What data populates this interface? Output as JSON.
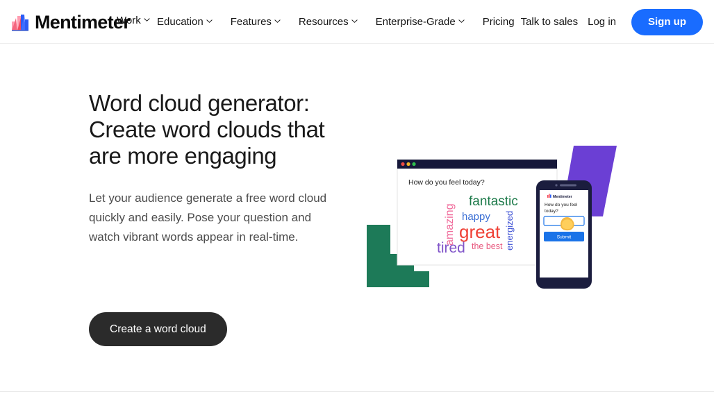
{
  "brand": {
    "name": "Mentimeter",
    "logo_icon": "mentimeter-bars-logo-icon",
    "colors": {
      "pink": "#ff9cb0",
      "red": "#f24b5e",
      "blue": "#2b5cf5",
      "light_blue": "#5b8cff"
    }
  },
  "nav": {
    "items": [
      {
        "label": "Work",
        "has_chevron": true,
        "icon": "chevron-down-icon"
      },
      {
        "label": "Education",
        "has_chevron": true,
        "icon": "chevron-down-icon"
      },
      {
        "label": "Features",
        "has_chevron": true,
        "icon": "chevron-down-icon"
      },
      {
        "label": "Resources",
        "has_chevron": true,
        "icon": "chevron-down-icon"
      },
      {
        "label": "Enterprise-Grade",
        "has_chevron": true,
        "icon": "chevron-down-icon"
      },
      {
        "label": "Pricing",
        "has_chevron": false,
        "icon": ""
      }
    ],
    "talk_to_sales": "Talk to sales",
    "login": "Log in",
    "signup": "Sign up",
    "signup_color": "#196cff"
  },
  "hero": {
    "title": "Word cloud generator: Create word clouds that are more engaging",
    "subtitle": "Let your audience generate a free word cloud quickly and easily. Pose your question and watch vibrant words appear in real-time.",
    "cta_label": "Create a word cloud",
    "cta_color": "#2b2b2b"
  },
  "illustration": {
    "browser": {
      "title_bar_color": "#16183a",
      "dots": [
        {
          "name": "close-dot",
          "color": "#ef4b43"
        },
        {
          "name": "minimize-dot",
          "color": "#f0b429"
        },
        {
          "name": "maximize-dot",
          "color": "#2fc04e"
        }
      ],
      "question": "How do you feel today?"
    },
    "word_cloud": {
      "words": [
        {
          "text": "fantastic",
          "color": "#1d7a4a",
          "size": 19,
          "rotation": 0
        },
        {
          "text": "happy",
          "color": "#3b6fd4",
          "size": 15,
          "rotation": 0
        },
        {
          "text": "great",
          "color": "#ef4136",
          "size": 25,
          "rotation": 0
        },
        {
          "text": "tired",
          "color": "#8054c9",
          "size": 21,
          "rotation": 0
        },
        {
          "text": "amazing",
          "color": "#f06a9a",
          "size": 15,
          "rotation": -90
        },
        {
          "text": "energized",
          "color": "#3b4fd4",
          "size": 13,
          "rotation": -90
        },
        {
          "text": "the best",
          "color": "#e8597f",
          "size": 12,
          "rotation": 0
        }
      ]
    },
    "phone": {
      "brand_label": "Mentimeter",
      "question": "How do you feel today?",
      "input_value": "",
      "submit_label": "Submit",
      "submit_color": "#1a73e8",
      "frame_color": "#1b1d3e",
      "hand_icon": "pointing-hand-icon"
    },
    "shapes": {
      "green_stairs_color": "#1d7a58",
      "purple_parallelogram_color": "#6b3fd4"
    }
  }
}
